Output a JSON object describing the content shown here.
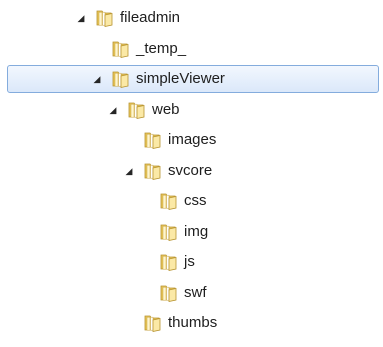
{
  "tree": {
    "nodes": [
      {
        "label": "fileadmin",
        "level": 0,
        "expanded": true,
        "has_children": true,
        "selected": false
      },
      {
        "label": "_temp_",
        "level": 1,
        "expanded": false,
        "has_children": false,
        "selected": false
      },
      {
        "label": "simpleViewer",
        "level": 1,
        "expanded": true,
        "has_children": true,
        "selected": true
      },
      {
        "label": "web",
        "level": 2,
        "expanded": true,
        "has_children": true,
        "selected": false
      },
      {
        "label": "images",
        "level": 3,
        "expanded": false,
        "has_children": false,
        "selected": false
      },
      {
        "label": "svcore",
        "level": 3,
        "expanded": true,
        "has_children": true,
        "selected": false
      },
      {
        "label": "css",
        "level": 4,
        "expanded": false,
        "has_children": false,
        "selected": false
      },
      {
        "label": "img",
        "level": 4,
        "expanded": false,
        "has_children": false,
        "selected": false
      },
      {
        "label": "js",
        "level": 4,
        "expanded": false,
        "has_children": false,
        "selected": false
      },
      {
        "label": "swf",
        "level": 4,
        "expanded": false,
        "has_children": false,
        "selected": false
      },
      {
        "label": "thumbs",
        "level": 3,
        "expanded": false,
        "has_children": false,
        "selected": false
      }
    ]
  },
  "icons": {
    "expanded_arrow": "◢",
    "folder": "folder-icon"
  },
  "colors": {
    "selection_border": "#84acdd",
    "selection_fill": "#dbe8fa",
    "folder_body": "#e8c65a",
    "folder_light": "#fbe9a6"
  }
}
